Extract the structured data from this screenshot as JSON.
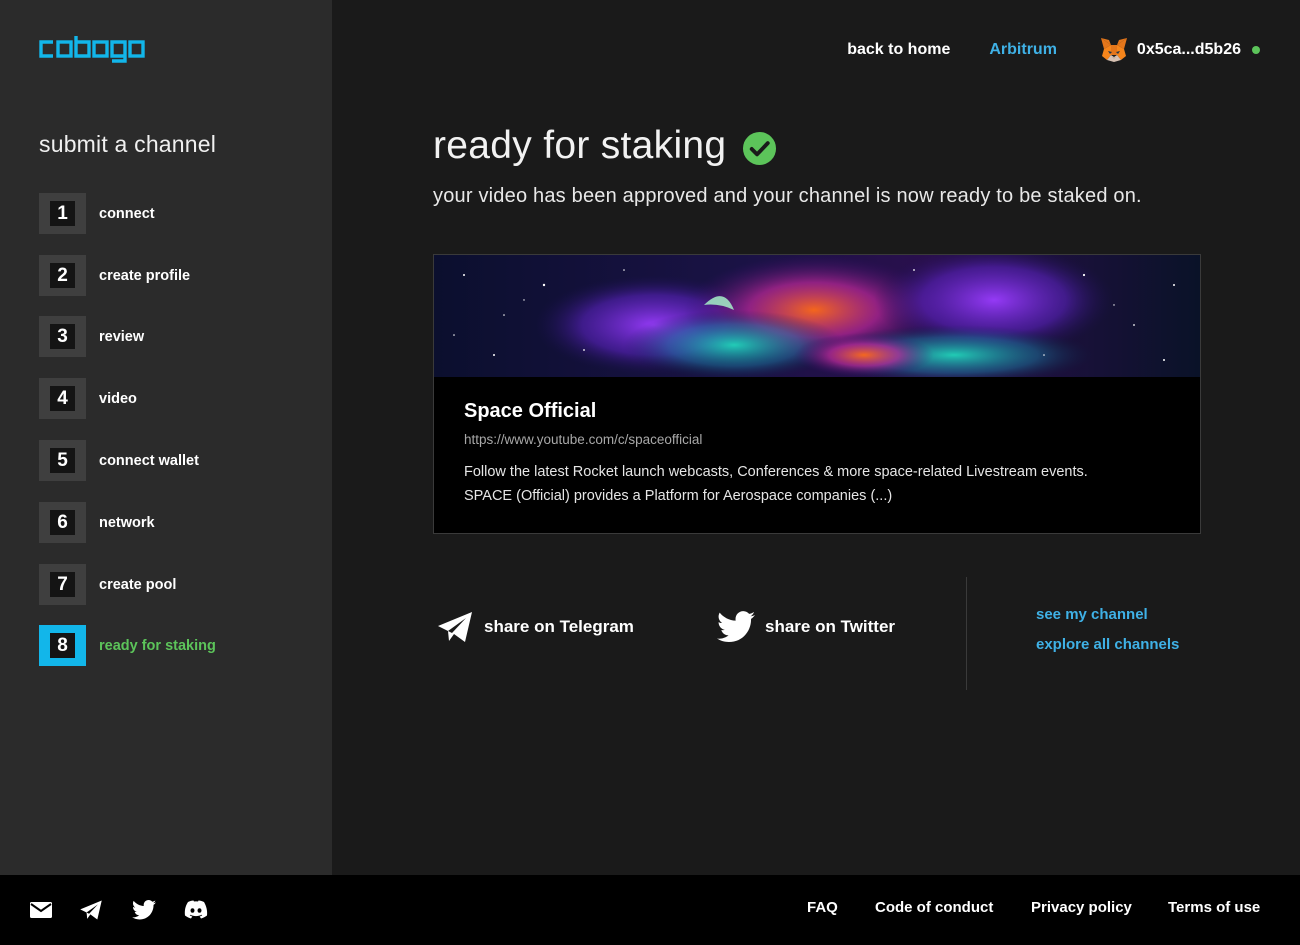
{
  "app": {
    "logo_text": "cobogo"
  },
  "colors": {
    "accent": "#12b6ea",
    "link": "#3fb1e6",
    "success": "#5cc45a"
  },
  "sidebar": {
    "title": "submit a channel",
    "steps": [
      {
        "number": "1",
        "label": "connect"
      },
      {
        "number": "2",
        "label": "create profile"
      },
      {
        "number": "3",
        "label": "review"
      },
      {
        "number": "4",
        "label": "video"
      },
      {
        "number": "5",
        "label": "connect wallet"
      },
      {
        "number": "6",
        "label": "network"
      },
      {
        "number": "7",
        "label": "create pool"
      },
      {
        "number": "8",
        "label": "ready for staking"
      }
    ],
    "active_step": "8"
  },
  "header": {
    "back_label": "back to home",
    "network": "Arbitrum",
    "wallet_icon": "metamask-fox-icon",
    "wallet_address": "0x5ca...d5b26"
  },
  "main": {
    "title": "ready for staking",
    "title_icon": "check-circle-icon",
    "subtitle": "your video has been approved and your channel is now ready to be staked on."
  },
  "channel": {
    "name": "Space Official",
    "url": "https://www.youtube.com/c/spaceofficial",
    "description_line1": "Follow the latest Rocket launch webcasts, Conferences & more space-related Livestream events.",
    "description_line2": "SPACE (Official) provides a Platform for Aerospace companies (...)"
  },
  "share": {
    "telegram_label": "share on Telegram",
    "twitter_label": "share on Twitter"
  },
  "links": {
    "see_channel": "see my channel",
    "explore": "explore all channels"
  },
  "footer": {
    "icons": [
      "mail-icon",
      "telegram-icon",
      "twitter-icon",
      "discord-icon"
    ],
    "links": [
      "FAQ",
      "Code of conduct",
      "Privacy policy",
      "Terms of use"
    ]
  }
}
